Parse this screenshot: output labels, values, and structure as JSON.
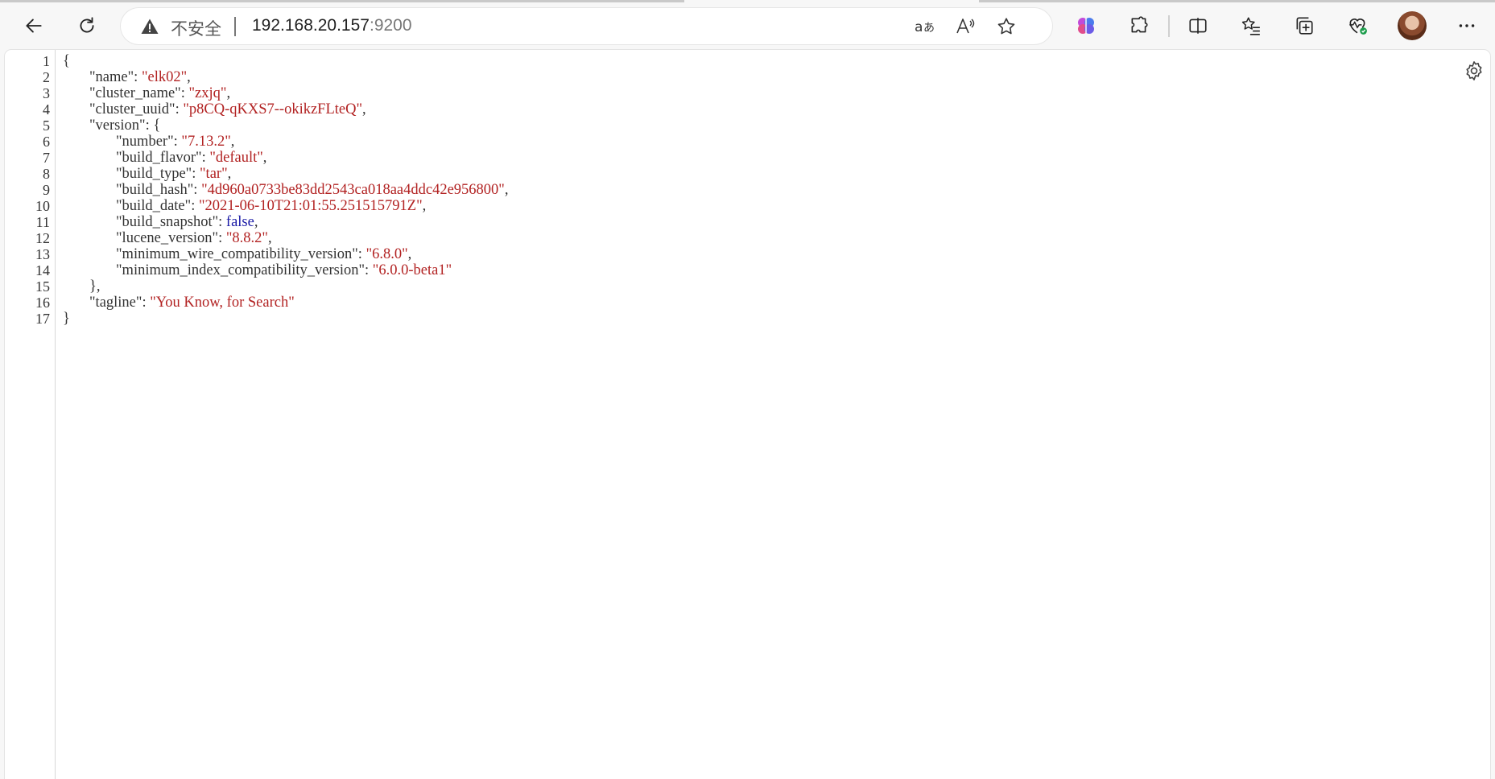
{
  "browser": {
    "security_label": "不安全",
    "url_host": "192.168.20.157",
    "url_port": ":9200"
  },
  "json_view": {
    "lines": [
      {
        "n": "1",
        "indent": 0,
        "parts": [
          {
            "t": "{",
            "c": "punc"
          }
        ]
      },
      {
        "n": "2",
        "indent": 1,
        "parts": [
          {
            "t": "\"name\"",
            "c": "key"
          },
          {
            "t": ": ",
            "c": "punc"
          },
          {
            "t": "\"elk02\"",
            "c": "str"
          },
          {
            "t": ",",
            "c": "punc"
          }
        ]
      },
      {
        "n": "3",
        "indent": 1,
        "parts": [
          {
            "t": "\"cluster_name\"",
            "c": "key"
          },
          {
            "t": ": ",
            "c": "punc"
          },
          {
            "t": "\"zxjq\"",
            "c": "str"
          },
          {
            "t": ",",
            "c": "punc"
          }
        ]
      },
      {
        "n": "4",
        "indent": 1,
        "parts": [
          {
            "t": "\"cluster_uuid\"",
            "c": "key"
          },
          {
            "t": ": ",
            "c": "punc"
          },
          {
            "t": "\"p8CQ-qKXS7--okikzFLteQ\"",
            "c": "str"
          },
          {
            "t": ",",
            "c": "punc"
          }
        ]
      },
      {
        "n": "5",
        "indent": 1,
        "parts": [
          {
            "t": "\"version\"",
            "c": "key"
          },
          {
            "t": ": {",
            "c": "punc"
          }
        ]
      },
      {
        "n": "6",
        "indent": 2,
        "parts": [
          {
            "t": "\"number\"",
            "c": "key"
          },
          {
            "t": ": ",
            "c": "punc"
          },
          {
            "t": "\"7.13.2\"",
            "c": "str"
          },
          {
            "t": ",",
            "c": "punc"
          }
        ]
      },
      {
        "n": "7",
        "indent": 2,
        "parts": [
          {
            "t": "\"build_flavor\"",
            "c": "key"
          },
          {
            "t": ": ",
            "c": "punc"
          },
          {
            "t": "\"default\"",
            "c": "str"
          },
          {
            "t": ",",
            "c": "punc"
          }
        ]
      },
      {
        "n": "8",
        "indent": 2,
        "parts": [
          {
            "t": "\"build_type\"",
            "c": "key"
          },
          {
            "t": ": ",
            "c": "punc"
          },
          {
            "t": "\"tar\"",
            "c": "str"
          },
          {
            "t": ",",
            "c": "punc"
          }
        ]
      },
      {
        "n": "9",
        "indent": 2,
        "parts": [
          {
            "t": "\"build_hash\"",
            "c": "key"
          },
          {
            "t": ": ",
            "c": "punc"
          },
          {
            "t": "\"4d960a0733be83dd2543ca018aa4ddc42e956800\"",
            "c": "str"
          },
          {
            "t": ",",
            "c": "punc"
          }
        ]
      },
      {
        "n": "10",
        "indent": 2,
        "parts": [
          {
            "t": "\"build_date\"",
            "c": "key"
          },
          {
            "t": ": ",
            "c": "punc"
          },
          {
            "t": "\"2021-06-10T21:01:55.251515791Z\"",
            "c": "str"
          },
          {
            "t": ",",
            "c": "punc"
          }
        ]
      },
      {
        "n": "11",
        "indent": 2,
        "parts": [
          {
            "t": "\"build_snapshot\"",
            "c": "key"
          },
          {
            "t": ": ",
            "c": "punc"
          },
          {
            "t": "false",
            "c": "bool"
          },
          {
            "t": ",",
            "c": "punc"
          }
        ]
      },
      {
        "n": "12",
        "indent": 2,
        "parts": [
          {
            "t": "\"lucene_version\"",
            "c": "key"
          },
          {
            "t": ": ",
            "c": "punc"
          },
          {
            "t": "\"8.8.2\"",
            "c": "str"
          },
          {
            "t": ",",
            "c": "punc"
          }
        ]
      },
      {
        "n": "13",
        "indent": 2,
        "parts": [
          {
            "t": "\"minimum_wire_compatibility_version\"",
            "c": "key"
          },
          {
            "t": ": ",
            "c": "punc"
          },
          {
            "t": "\"6.8.0\"",
            "c": "str"
          },
          {
            "t": ",",
            "c": "punc"
          }
        ]
      },
      {
        "n": "14",
        "indent": 2,
        "parts": [
          {
            "t": "\"minimum_index_compatibility_version\"",
            "c": "key"
          },
          {
            "t": ": ",
            "c": "punc"
          },
          {
            "t": "\"6.0.0-beta1\"",
            "c": "str"
          }
        ]
      },
      {
        "n": "15",
        "indent": 1,
        "parts": [
          {
            "t": "},",
            "c": "punc"
          }
        ]
      },
      {
        "n": "16",
        "indent": 1,
        "parts": [
          {
            "t": "\"tagline\"",
            "c": "key"
          },
          {
            "t": ": ",
            "c": "punc"
          },
          {
            "t": "\"You Know, for Search\"",
            "c": "str"
          }
        ]
      },
      {
        "n": "17",
        "indent": 0,
        "parts": [
          {
            "t": "}",
            "c": "punc"
          }
        ]
      }
    ]
  }
}
